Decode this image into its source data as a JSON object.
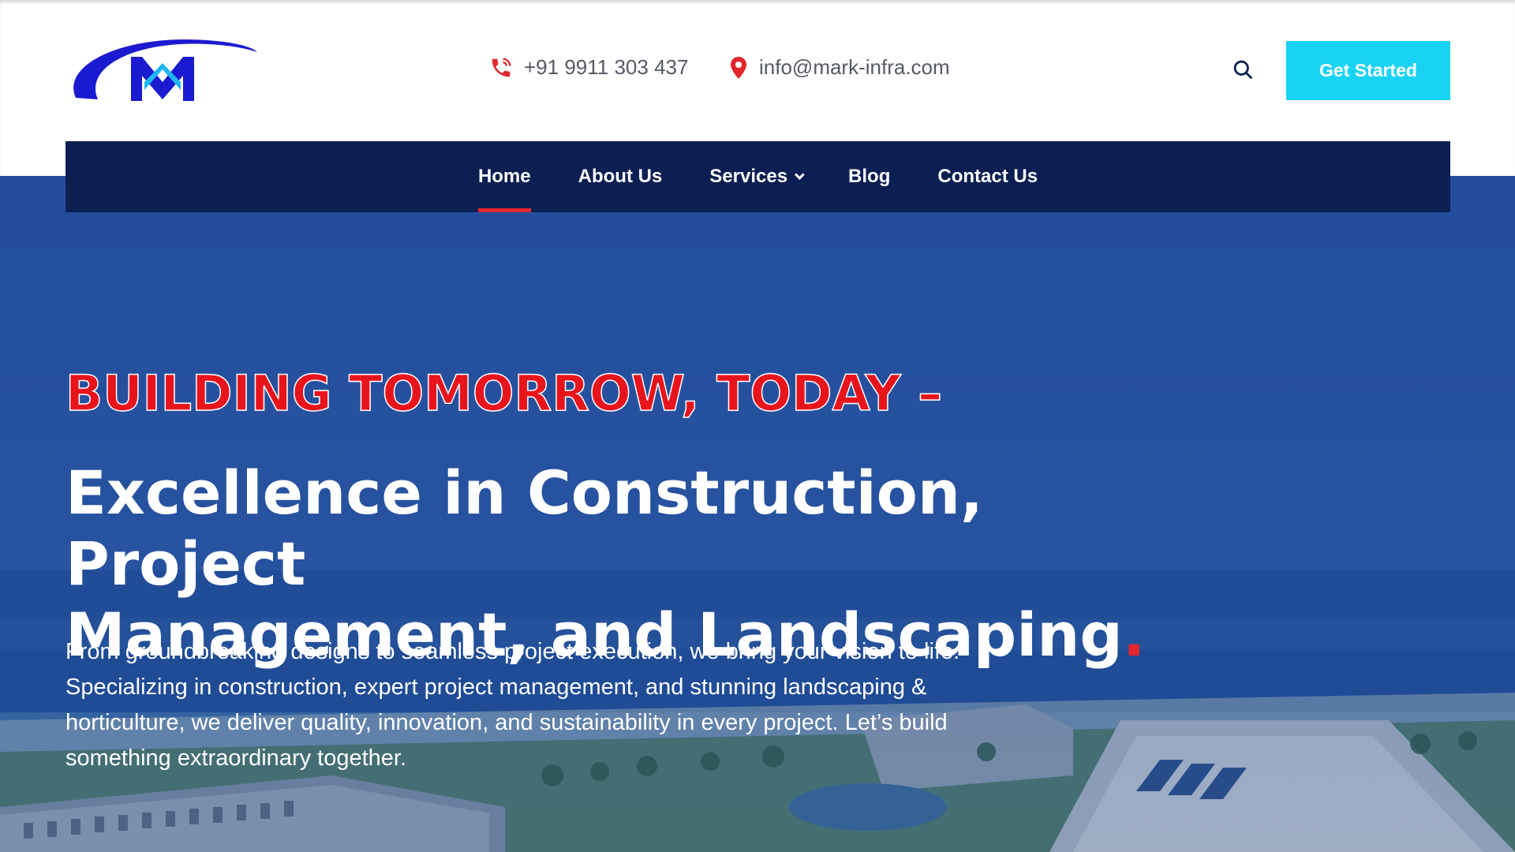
{
  "header": {
    "logo_alt": "M",
    "phone": "+91 9911 303 437",
    "email": "info@mark-infra.com",
    "cta_label": "Get Started"
  },
  "nav": {
    "items": [
      {
        "label": "Home",
        "active": true
      },
      {
        "label": "About Us"
      },
      {
        "label": "Services",
        "dropdown": true
      },
      {
        "label": "Blog"
      },
      {
        "label": "Contact Us"
      }
    ]
  },
  "hero": {
    "tagline": "BUILDING TOMORROW, TODAY –",
    "headline_line1": "Excellence in Construction, Project",
    "headline_line2": "Management, and Landscaping",
    "headline_dot": ".",
    "description": "From groundbreaking designs to seamless project execution, we bring your vision to life. Specializing in construction, expert project management, and stunning landscaping & horticulture, we deliver quality, innovation, and sustainability in every project. Let’s build something extraordinary together."
  },
  "colors": {
    "accent_red": "#e3262c",
    "nav_bg": "#0c1f52",
    "cta_bg": "#19d3f4",
    "logo_blue": "#1a1ad0",
    "logo_cyan": "#1fb6f0"
  },
  "icons": {
    "phone": "phone-icon",
    "location": "location-pin-icon",
    "search": "search-icon",
    "dropdown": "chevron-down-icon"
  }
}
